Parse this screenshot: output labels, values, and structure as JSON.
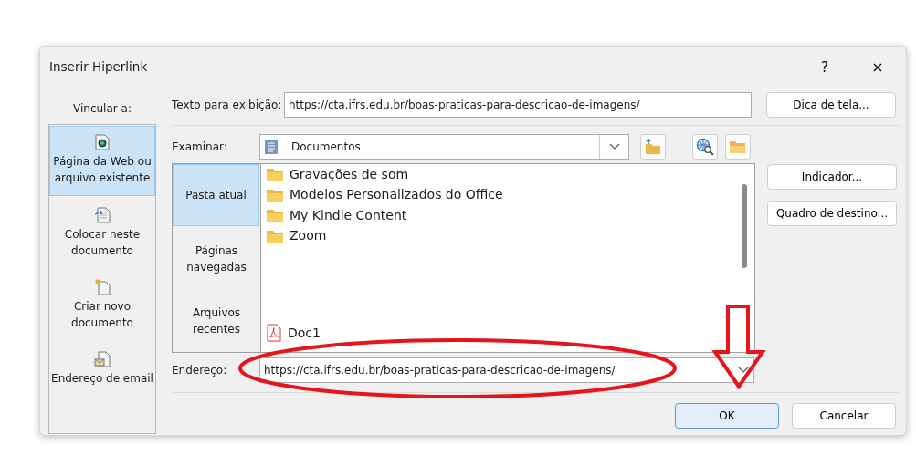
{
  "window": {
    "title": "Inserir Hiperlink",
    "help": "?",
    "close": "×"
  },
  "link_to": {
    "label": "Vincular a:",
    "items": [
      {
        "label": "Página da Web ou arquivo existente",
        "kind": "web",
        "selected": true
      },
      {
        "label": "Colocar neste documento",
        "kind": "place",
        "selected": false
      },
      {
        "label": "Criar novo documento",
        "kind": "new",
        "selected": false
      },
      {
        "label": "Endereço de email",
        "kind": "email",
        "selected": false
      }
    ]
  },
  "display_text": {
    "label": "Texto para exibição:",
    "value": "https://cta.ifrs.edu.br/boas-praticas-para-descricao-de-imagens/"
  },
  "screen_tip_button": "Dica de tela...",
  "look_in": {
    "label": "Examinar:",
    "value": "Documentos"
  },
  "browse_places": [
    {
      "label": "Pasta atual",
      "selected": true
    },
    {
      "label": "Páginas navegadas",
      "selected": false
    },
    {
      "label": "Arquivos recentes",
      "selected": false
    }
  ],
  "files": [
    {
      "name": "Gravações de som",
      "kind": "folder"
    },
    {
      "name": "Modelos Personalizados do Office",
      "kind": "folder"
    },
    {
      "name": "My Kindle Content",
      "kind": "folder"
    },
    {
      "name": "Zoom",
      "kind": "folder"
    },
    {
      "name": "Doc1",
      "kind": "pdf"
    }
  ],
  "side_buttons": [
    "Indicador...",
    "Quadro de destino..."
  ],
  "address": {
    "label": "Endereço:",
    "value": "https://cta.ifrs.edu.br/boas-praticas-para-descricao-de-imagens/"
  },
  "buttons": [
    {
      "label": "OK",
      "default": true
    },
    {
      "label": "Cancelar",
      "default": false
    }
  ]
}
